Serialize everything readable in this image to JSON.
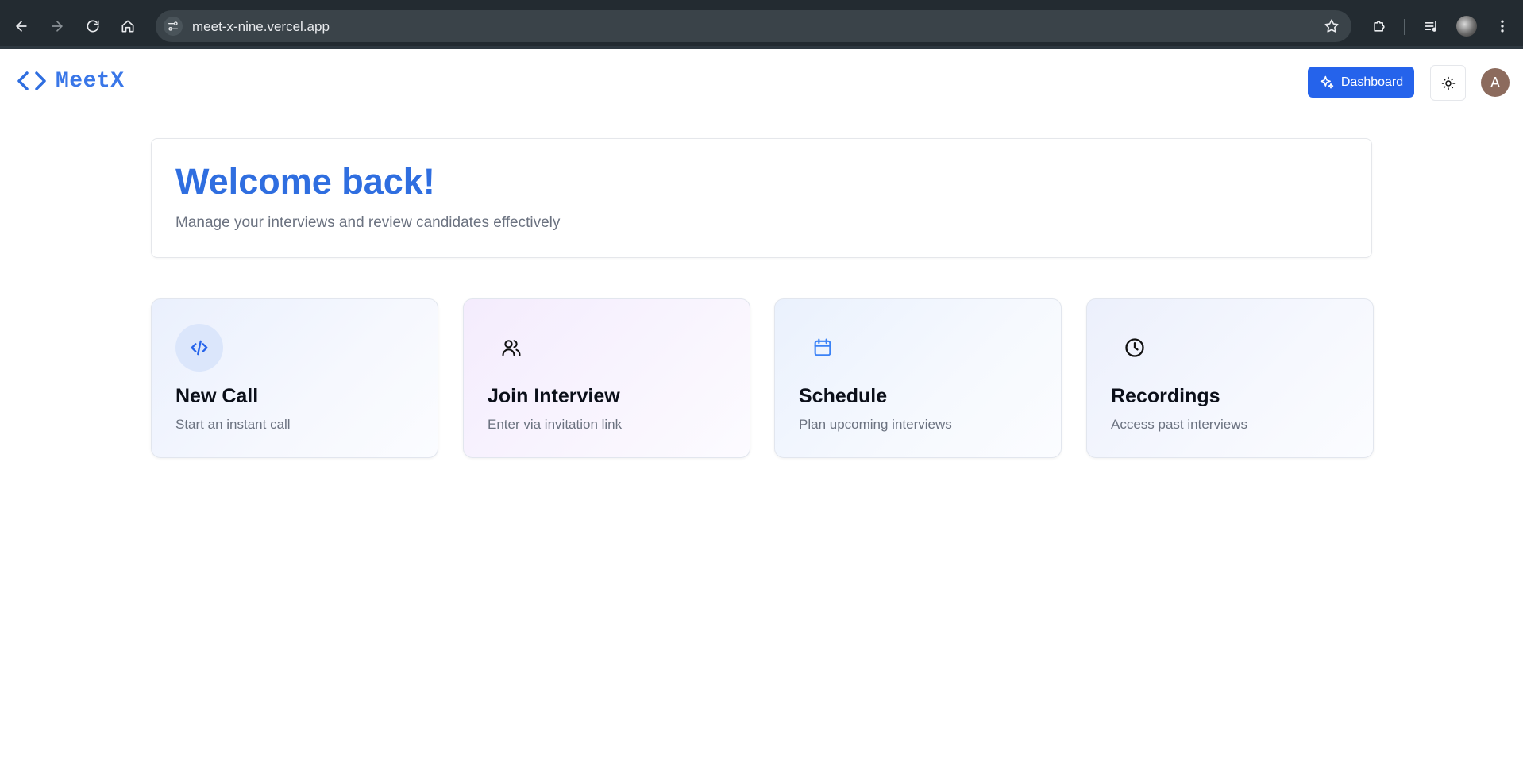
{
  "browser": {
    "url": "meet-x-nine.vercel.app"
  },
  "header": {
    "logo_text": "MeetX",
    "dashboard_label": "Dashboard",
    "avatar_initial": "A"
  },
  "welcome": {
    "title": "Welcome back!",
    "subtitle": "Manage your interviews and review candidates effectively"
  },
  "actions": [
    {
      "title": "New Call",
      "description": "Start an instant call",
      "icon": "code-icon"
    },
    {
      "title": "Join Interview",
      "description": "Enter via invitation link",
      "icon": "users-icon"
    },
    {
      "title": "Schedule",
      "description": "Plan upcoming interviews",
      "icon": "calendar-icon"
    },
    {
      "title": "Recordings",
      "description": "Access past interviews",
      "icon": "clock-icon"
    }
  ],
  "colors": {
    "accent": "#2563eb",
    "title_blue": "#2f6ee0",
    "muted_text": "#6b7280"
  }
}
